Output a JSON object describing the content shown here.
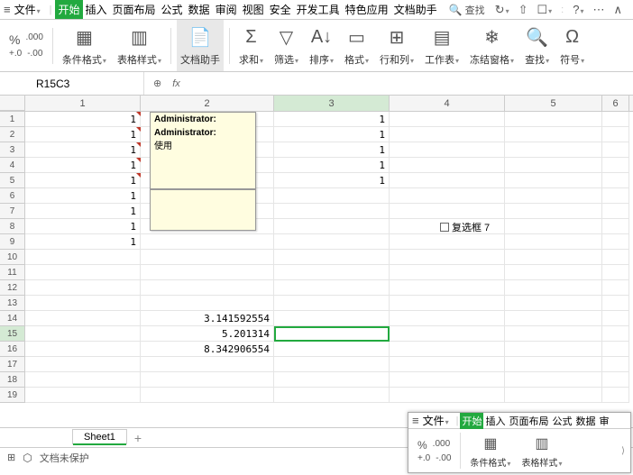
{
  "menubar": {
    "file": "文件",
    "tabs": [
      "开始",
      "插入",
      "页面布局",
      "公式",
      "数据",
      "审阅",
      "视图",
      "安全",
      "开发工具",
      "特色应用",
      "文档助手"
    ],
    "search": "查找"
  },
  "ribbon": {
    "percent": "%",
    "decimals1": ".000",
    "decimals2": "+.0",
    "decimals3": "-.00",
    "decimals4": ".00",
    "cond_fmt": "条件格式",
    "table_style": "表格样式",
    "doc_helper": "文档助手",
    "sum": "求和",
    "filter": "筛选",
    "sort": "排序",
    "format": "格式",
    "rowcol": "行和列",
    "worksheet": "工作表",
    "freeze": "冻结窗格",
    "find": "查找",
    "symbol": "符号"
  },
  "formula_bar": {
    "name_box": "R15C3",
    "fx": "fx"
  },
  "columns": {
    "c1": "1",
    "c2": "2",
    "c3": "3",
    "c4": "4",
    "c5": "5",
    "c6": "6"
  },
  "col_widths": {
    "w1": 128,
    "w2": 148,
    "w3": 128,
    "w4": 128,
    "w5": 108,
    "w6": 30
  },
  "cells": {
    "r1c1": "1",
    "r1c3": "1",
    "r2c1": "1",
    "r2c3": "1",
    "r3c1": "1",
    "r3c3": "1",
    "r4c1": "1",
    "r4c3": "1",
    "r5c1": "1",
    "r5c3": "1",
    "r6c1": "1",
    "r7c1": "1",
    "r8c1": "1",
    "r9c1": "1",
    "r14c2": "3.141592554",
    "r15c2": "5.201314",
    "r16c2": "8.342906554"
  },
  "comments": {
    "c1": "Administrator:",
    "c2": "Administrator:",
    "c3": "使用"
  },
  "checkbox": {
    "label": "复选框 7"
  },
  "sheet": {
    "name": "Sheet1"
  },
  "statusbar": {
    "protect": "文档未保护"
  },
  "mini": {
    "file": "文件",
    "tabs": [
      "开始",
      "插入",
      "页面布局",
      "公式",
      "数据",
      "审"
    ],
    "cond_fmt": "条件格式",
    "table_style": "表格样式",
    "percent": "%",
    "decimals1": ".000",
    "decimals2": "+.0",
    "decimals3": "-.00",
    "decimals4": ".00"
  },
  "chart_data": null
}
